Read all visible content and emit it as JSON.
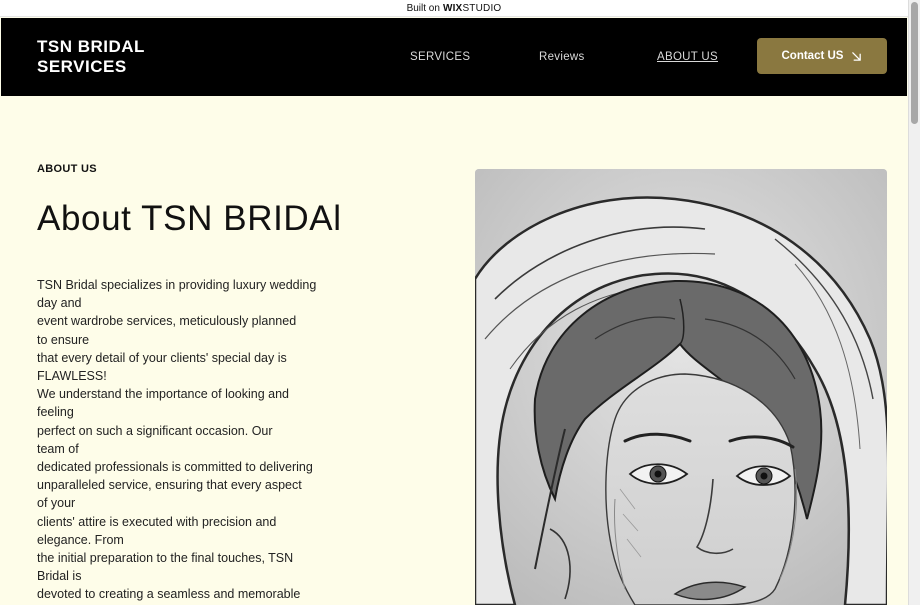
{
  "builder_banner": {
    "built_on": "Built on",
    "wix": "WIX",
    "studio": "STUDIO"
  },
  "header": {
    "brand_line1": "TSN BRIDAL",
    "brand_line2": "SERVICES",
    "nav": {
      "services": "SERVICES",
      "reviews": "Reviews",
      "about": "ABOUT US"
    },
    "contact_button": "Contact US",
    "active_nav": "ABOUT US"
  },
  "main": {
    "eyebrow": "ABOUT US",
    "title": "About TSN BRIDAl",
    "body_lines": [
      "TSN Bridal specializes in providing luxury wedding",
      "day and",
      "event wardrobe services,  meticulously  planned",
      "to  ensure",
      "that every detail of your clients' special day is",
      "FLAWLESS!",
      "We understand  the  importance  of  looking  and",
      "feeling",
      "perfect on such  a  significant  occasion.  Our",
      "team  of",
      "dedicated professionals is committed to  delivering",
      "unparalleled service, ensuring that every  aspect",
      "of  your",
      "clients' attire is executed with precision and",
      "elegance. From",
      "the initial preparation to the final touches, TSN",
      "Bridal is",
      "devoted to creating  a  seamless  and  memorable"
    ]
  },
  "colors": {
    "page_bg": "#fefde9",
    "header_bg": "#000000",
    "accent": "#8a7840"
  },
  "icons": {
    "contact_arrow": "arrow-down-right-icon",
    "portrait": "bride-sketch-image"
  }
}
